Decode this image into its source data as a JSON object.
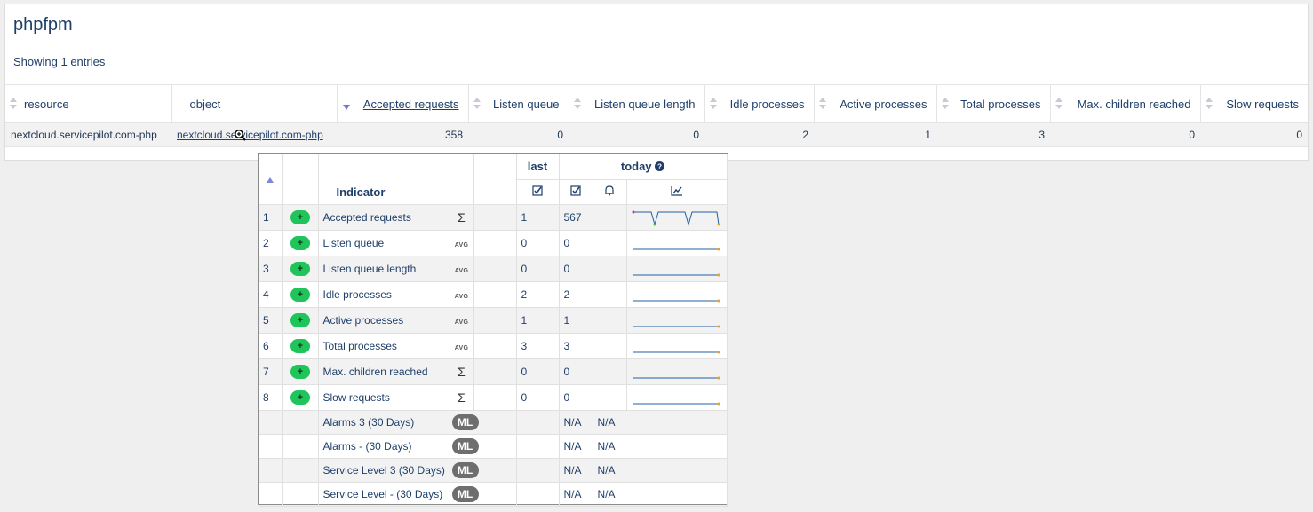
{
  "page": {
    "title": "phpfpm",
    "showing": "Showing 1 entries"
  },
  "table": {
    "columns": [
      "resource",
      "object",
      "Accepted requests",
      "Listen queue",
      "Listen queue length",
      "Idle processes",
      "Active processes",
      "Total processes",
      "Max. children reached",
      "Slow requests"
    ],
    "rows": [
      {
        "resource": "nextcloud.servicepilot.com-php",
        "object": "nextcloud.servicepilot.com-php",
        "accepted_requests": "358",
        "listen_queue": "0",
        "listen_queue_length": "0",
        "idle_processes": "2",
        "active_processes": "1",
        "total_processes": "3",
        "max_children_reached": "0",
        "slow_requests": "0"
      }
    ]
  },
  "popup": {
    "header_indicator": "Indicator",
    "header_last": "last",
    "header_today": "today",
    "indicators": [
      {
        "num": "1",
        "plus": "+",
        "name": "Accepted requests",
        "agg": "Σ",
        "last": "1",
        "today": "567"
      },
      {
        "num": "2",
        "plus": "+",
        "name": "Listen queue",
        "agg": "AVG",
        "last": "0",
        "today": "0"
      },
      {
        "num": "3",
        "plus": "+",
        "name": "Listen queue length",
        "agg": "AVG",
        "last": "0",
        "today": "0"
      },
      {
        "num": "4",
        "plus": "+",
        "name": "Idle processes",
        "agg": "AVG",
        "last": "2",
        "today": "2"
      },
      {
        "num": "5",
        "plus": "+",
        "name": "Active processes",
        "agg": "AVG",
        "last": "1",
        "today": "1"
      },
      {
        "num": "6",
        "plus": "+",
        "name": "Total processes",
        "agg": "AVG",
        "last": "3",
        "today": "3"
      },
      {
        "num": "7",
        "plus": "+",
        "name": "Max. children reached",
        "agg": "Σ",
        "last": "0",
        "today": "0"
      },
      {
        "num": "8",
        "plus": "+",
        "name": "Slow requests",
        "agg": "Σ",
        "last": "0",
        "today": "0"
      }
    ],
    "summaries": [
      {
        "name": "Alarms 3 (30 Days)",
        "badge": "ML",
        "val1": "N/A",
        "val2": "N/A"
      },
      {
        "name": "Alarms - (30 Days)",
        "badge": "ML",
        "val1": "N/A",
        "val2": "N/A"
      },
      {
        "name": "Service Level 3 (30 Days)",
        "badge": "ML",
        "val1": "N/A",
        "val2": "N/A"
      },
      {
        "name": "Service Level - (30 Days)",
        "badge": "ML",
        "val1": "N/A",
        "val2": "N/A"
      }
    ]
  },
  "icons": {
    "sort": "sort-icon",
    "help": "help-circle-icon",
    "check": "checkbox-checked-icon",
    "bell": "bell-icon",
    "chart": "line-chart-icon",
    "cursor": "magnifier-cursor-icon"
  },
  "colors": {
    "text": "#1f3f6a",
    "plus_badge": "#1fc55b",
    "ml_badge": "#6e6e6e",
    "sort_active": "#6f78d8",
    "spark_line": "#1f5fa8"
  }
}
